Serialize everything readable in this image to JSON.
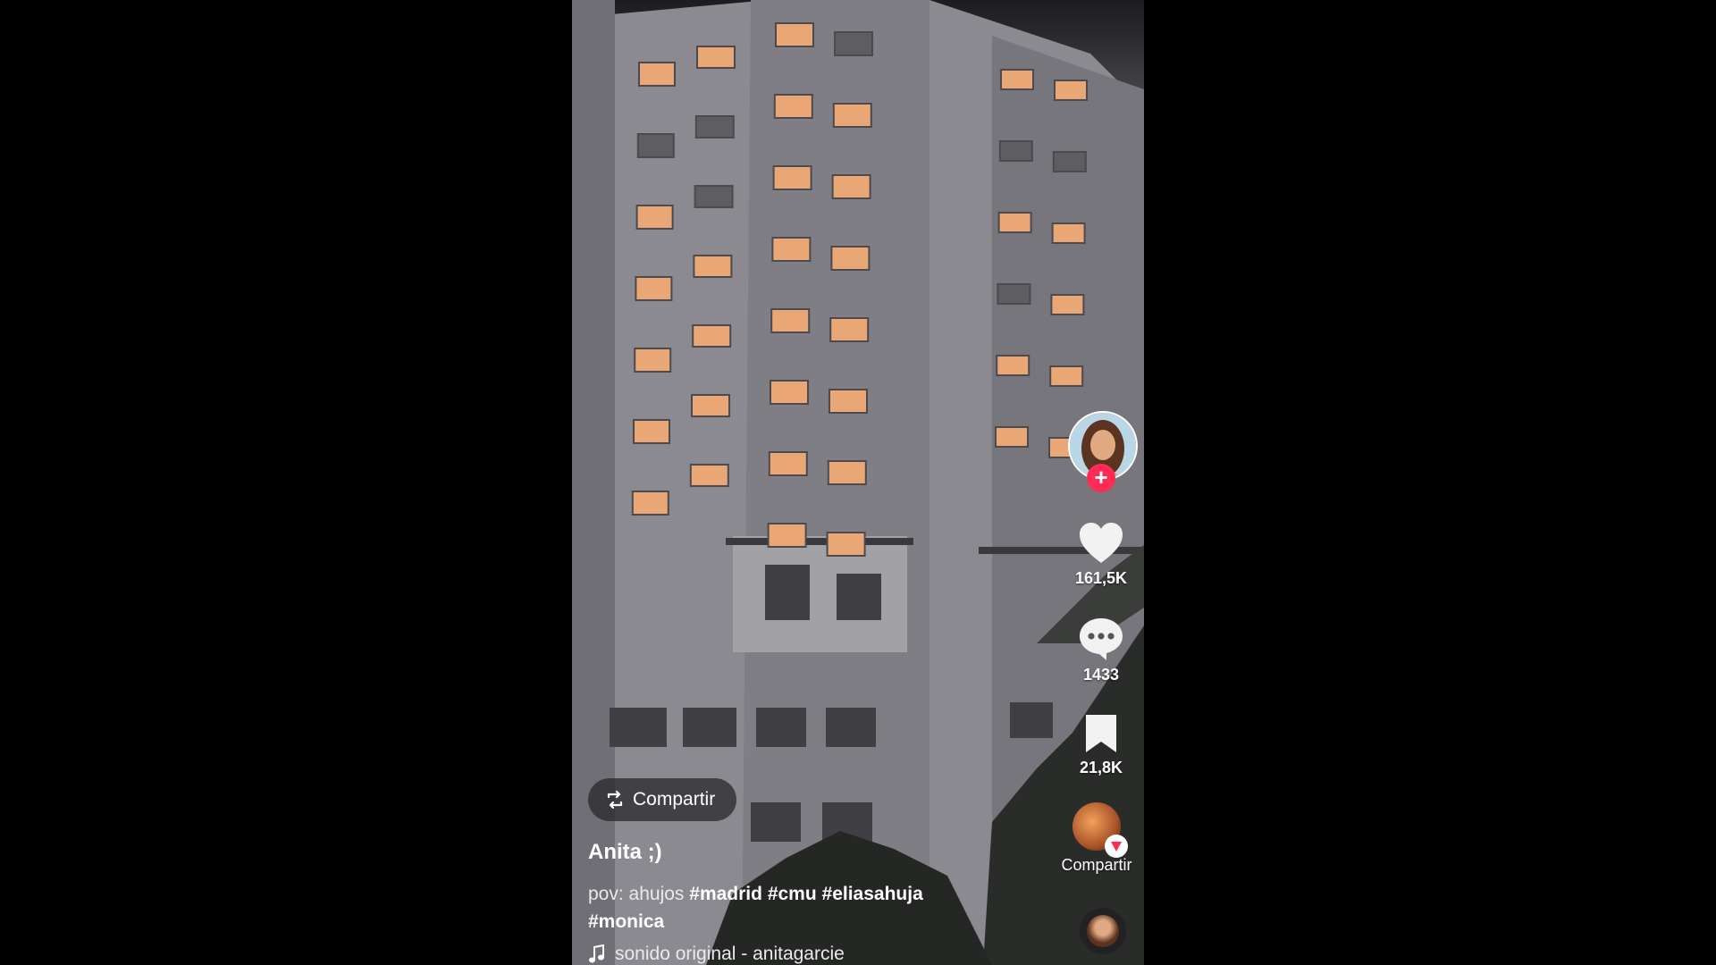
{
  "post": {
    "username": "Anita ;)",
    "caption_prefix": "pov: ahujos",
    "hashtags": [
      "#madrid",
      "#cmu",
      "#eliasahuja",
      "#monica"
    ],
    "sound": "sonido original - anitagarcie"
  },
  "actions": {
    "likes": "161,5K",
    "comments": "1433",
    "saves": "21,8K",
    "share_label": "Compartir",
    "repost_label": "Compartir"
  },
  "colors": {
    "follow_accent": "#fe2c55",
    "window_light": "#e8a774"
  },
  "icons": [
    "repost-icon",
    "heart-icon",
    "comment-icon",
    "bookmark-icon",
    "music-note-icon",
    "plus-icon"
  ]
}
